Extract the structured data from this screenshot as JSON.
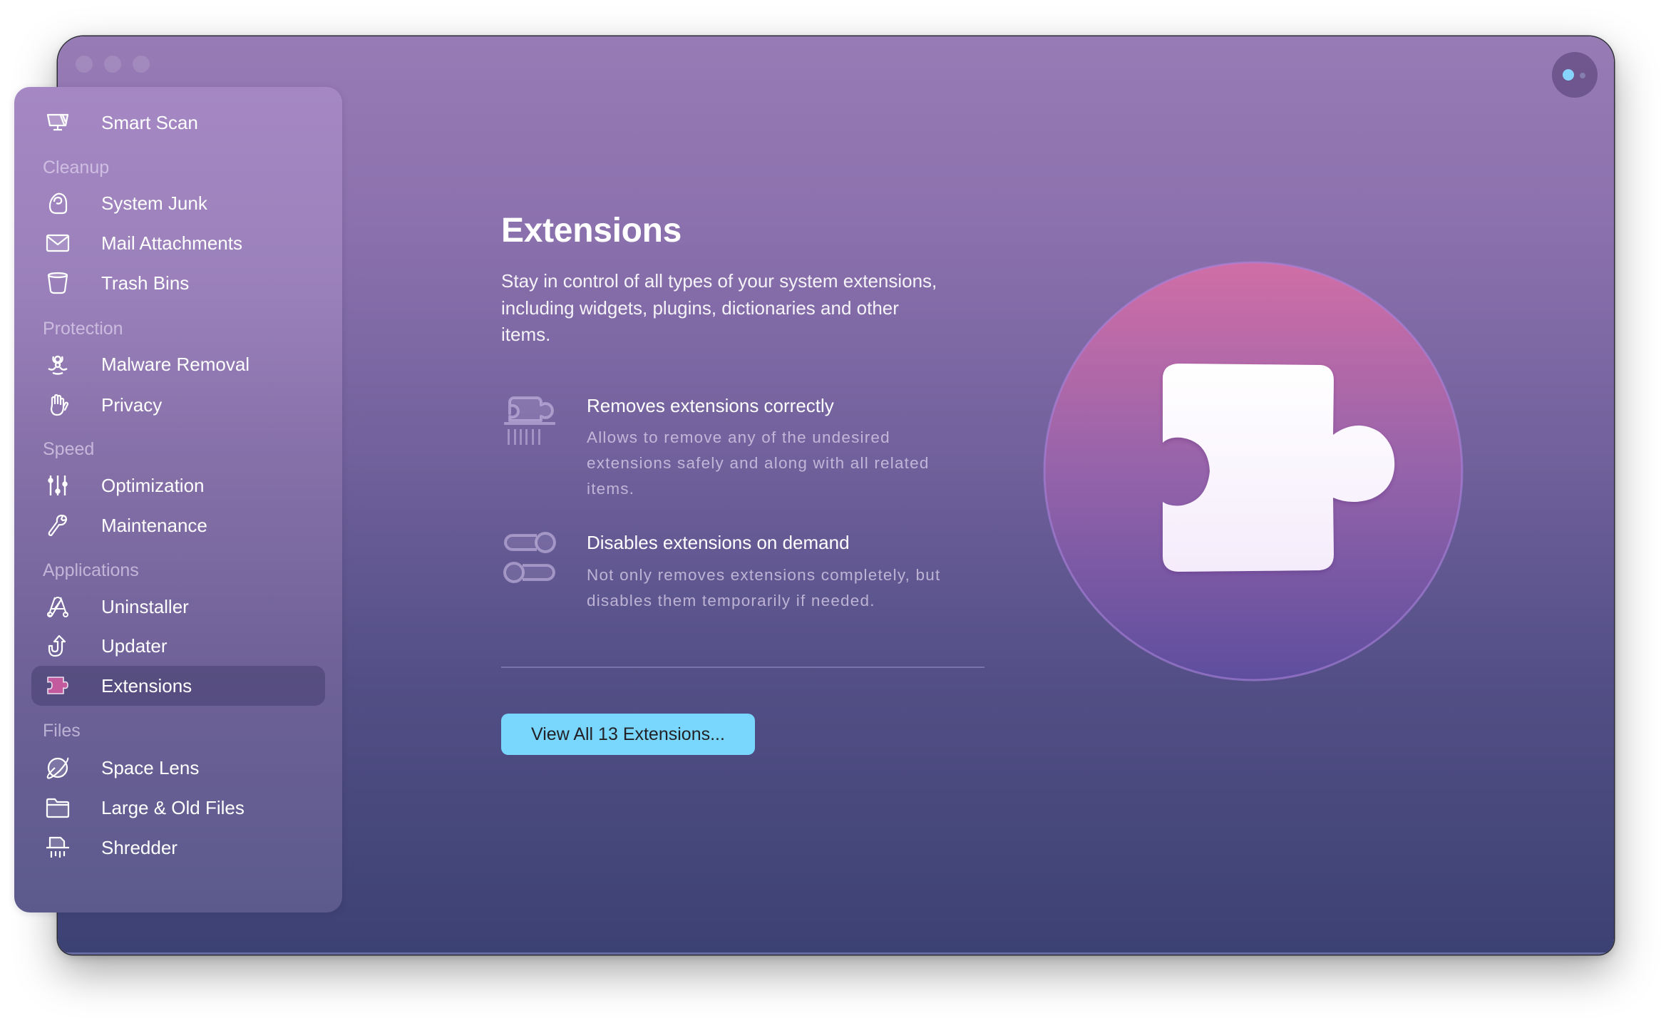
{
  "window": {
    "traffic_lights": [
      "close",
      "minimize",
      "zoom"
    ],
    "profile_button": {
      "icon": "assistant-dots-icon"
    }
  },
  "sidebar": {
    "top_item": {
      "label": "Smart Scan",
      "icon": "monitor-icon"
    },
    "sections": [
      {
        "header": "Cleanup",
        "items": [
          {
            "label": "System Junk",
            "icon": "system-junk-icon"
          },
          {
            "label": "Mail Attachments",
            "icon": "envelope-icon"
          },
          {
            "label": "Trash Bins",
            "icon": "trash-bin-icon"
          }
        ]
      },
      {
        "header": "Protection",
        "items": [
          {
            "label": "Malware Removal",
            "icon": "biohazard-icon"
          },
          {
            "label": "Privacy",
            "icon": "hand-icon"
          }
        ]
      },
      {
        "header": "Speed",
        "items": [
          {
            "label": "Optimization",
            "icon": "sliders-icon"
          },
          {
            "label": "Maintenance",
            "icon": "wrench-icon"
          }
        ]
      },
      {
        "header": "Applications",
        "items": [
          {
            "label": "Uninstaller",
            "icon": "app-store-icon"
          },
          {
            "label": "Updater",
            "icon": "update-arrow-icon"
          },
          {
            "label": "Extensions",
            "icon": "puzzle-icon",
            "selected": true
          }
        ]
      },
      {
        "header": "Files",
        "items": [
          {
            "label": "Space Lens",
            "icon": "planet-icon"
          },
          {
            "label": "Large & Old Files",
            "icon": "folder-icon"
          },
          {
            "label": "Shredder",
            "icon": "shredder-icon"
          }
        ]
      }
    ]
  },
  "main": {
    "title": "Extensions",
    "description_lines": [
      "Stay in control of all types of your system extensions,",
      "including widgets, plugins, dictionaries and other",
      "items."
    ],
    "features": [
      {
        "icon": "puzzle-shredder-icon",
        "title": "Removes extensions correctly",
        "description_lines": [
          "Allows to remove any of the undesired",
          "extensions safely and along with all related",
          "items."
        ]
      },
      {
        "icon": "toggles-icon",
        "title": "Disables extensions on demand",
        "description_lines": [
          "Not only removes extensions completely, but",
          "disables them temporarily if needed."
        ]
      }
    ],
    "cta_label": "View All 13 Extensions...",
    "hero_icon": "puzzle-piece-icon"
  },
  "colors": {
    "accent_button": "#79d6fd",
    "selected_icon": "#c45a9e",
    "profile_dot": "#86d4fb",
    "hero_top": "#d06ea6",
    "hero_bottom": "#5e4e9e"
  }
}
